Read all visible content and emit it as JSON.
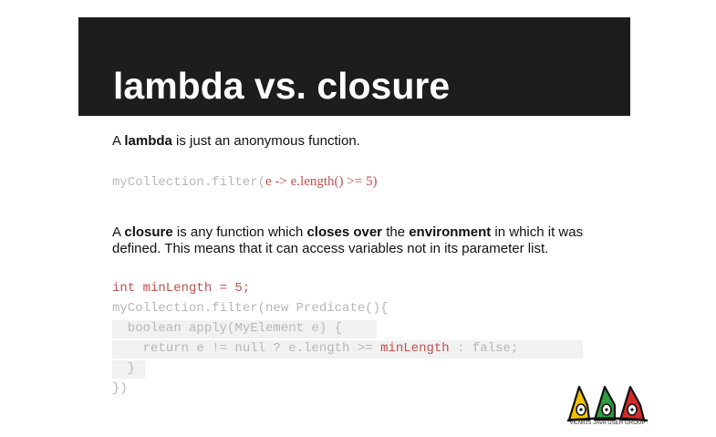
{
  "slide": {
    "title": "lambda vs. closure",
    "lambda_sentence": {
      "prefix": "A ",
      "term": "lambda",
      "suffix": " is just an anonymous function."
    },
    "lambda_code": {
      "part1": "myCollection.filter(",
      "part2": "e -> e.length() >= 5",
      "part3": ")"
    },
    "closure_sentence": {
      "p1": "A ",
      "b1": "closure",
      "p2": " is any function which ",
      "b2": "closes over",
      "p3": " the ",
      "b3": "environment",
      "p4": " in which it was",
      "line2": "defined. This means that it can access variables not in its parameter list."
    },
    "closure_code": {
      "line1": "int minLength = 5;",
      "line2": "myCollection.filter(new Predicate(){",
      "line3": "  boolean apply(MyElement e) {",
      "line4a": "    return e != null ? e.length >= ",
      "line4b": "minLength",
      "line4c": " : false;",
      "line5": "  }",
      "line6": "})"
    },
    "logo": {
      "caption": "VILNIUS JAVA USER GROUP",
      "colors": [
        "#f2c300",
        "#2e9e3e",
        "#d42a2a"
      ]
    }
  }
}
